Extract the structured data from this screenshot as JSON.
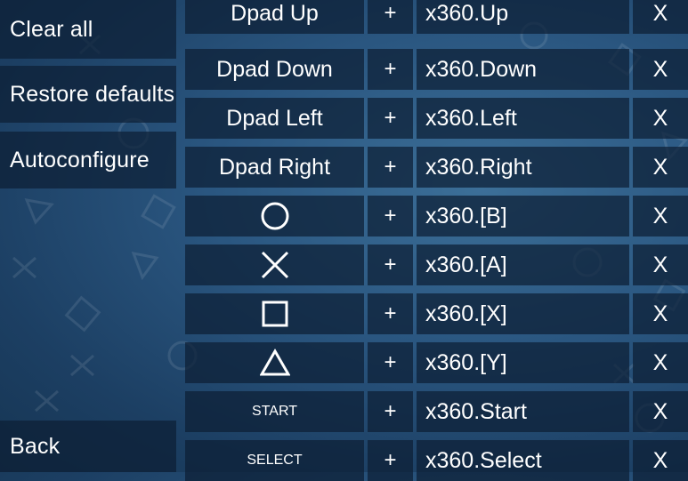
{
  "sidebar": {
    "clear_all": "Clear all",
    "restore_defaults": "Restore defaults",
    "autoconfigure": "Autoconfigure",
    "back": "Back"
  },
  "mappings": [
    {
      "key": "Dpad Up",
      "key_type": "text",
      "plus": "+",
      "mapping": "x360.Up",
      "remove": "X"
    },
    {
      "key": "Dpad Down",
      "key_type": "text",
      "plus": "+",
      "mapping": "x360.Down",
      "remove": "X"
    },
    {
      "key": "Dpad Left",
      "key_type": "text",
      "plus": "+",
      "mapping": "x360.Left",
      "remove": "X"
    },
    {
      "key": "Dpad Right",
      "key_type": "text",
      "plus": "+",
      "mapping": "x360.Right",
      "remove": "X"
    },
    {
      "key": "circle-icon",
      "key_type": "icon",
      "plus": "+",
      "mapping": "x360.[B]",
      "remove": "X"
    },
    {
      "key": "cross-icon",
      "key_type": "icon",
      "plus": "+",
      "mapping": "x360.[A]",
      "remove": "X"
    },
    {
      "key": "square-icon",
      "key_type": "icon",
      "plus": "+",
      "mapping": "x360.[X]",
      "remove": "X"
    },
    {
      "key": "triangle-icon",
      "key_type": "icon",
      "plus": "+",
      "mapping": "x360.[Y]",
      "remove": "X"
    },
    {
      "key": "START",
      "key_type": "small-text",
      "plus": "+",
      "mapping": "x360.Start",
      "remove": "X"
    },
    {
      "key": "SELECT",
      "key_type": "small-text",
      "plus": "+",
      "mapping": "x360.Select",
      "remove": "X"
    }
  ],
  "colors": {
    "background": "#2a5680",
    "panel": "#0c1e34",
    "text": "#ffffff"
  }
}
